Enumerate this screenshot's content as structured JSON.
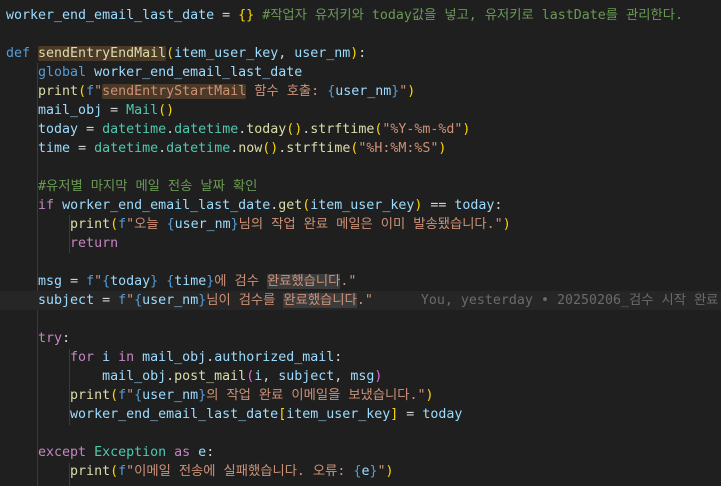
{
  "editor": {
    "lines": [
      [
        [
          "var",
          "worker_end_email_last_date"
        ],
        [
          "op",
          " = "
        ],
        [
          "p1",
          "{}"
        ],
        [
          "cm",
          " #작업자 유저키와 today값을 넣고, 유저키로 lastDate를 관리한다."
        ]
      ],
      [],
      [
        [
          "kw",
          "def "
        ],
        [
          "fn hl",
          "sendEntryEndMail"
        ],
        [
          "p1",
          "("
        ],
        [
          "var",
          "item_user_key"
        ],
        [
          "op",
          ", "
        ],
        [
          "var",
          "user_nm"
        ],
        [
          "p1",
          ")"
        ],
        [
          "op",
          ":"
        ]
      ],
      [
        [
          "op",
          "    "
        ],
        [
          "kw",
          "global "
        ],
        [
          "var",
          "worker_end_email_last_date"
        ]
      ],
      [
        [
          "op",
          "    "
        ],
        [
          "fn",
          "print"
        ],
        [
          "p1",
          "("
        ],
        [
          "kw",
          "f"
        ],
        [
          "str",
          "\""
        ],
        [
          "str hl",
          "sendEntryStartMail"
        ],
        [
          "str",
          " 함수 호출: "
        ],
        [
          "kw",
          "{"
        ],
        [
          "var",
          "user_nm"
        ],
        [
          "kw",
          "}"
        ],
        [
          "str",
          "\""
        ],
        [
          "p1",
          ")"
        ]
      ],
      [
        [
          "op",
          "    "
        ],
        [
          "var",
          "mail_obj"
        ],
        [
          "op",
          " = "
        ],
        [
          "cls",
          "Mail"
        ],
        [
          "p1",
          "()"
        ]
      ],
      [
        [
          "op",
          "    "
        ],
        [
          "var",
          "today"
        ],
        [
          "op",
          " = "
        ],
        [
          "cls",
          "datetime"
        ],
        [
          "op",
          "."
        ],
        [
          "cls",
          "datetime"
        ],
        [
          "op",
          "."
        ],
        [
          "fn",
          "today"
        ],
        [
          "p1",
          "()"
        ],
        [
          "op",
          "."
        ],
        [
          "fn",
          "strftime"
        ],
        [
          "p1",
          "("
        ],
        [
          "str",
          "\"%Y-%m-%d\""
        ],
        [
          "p1",
          ")"
        ]
      ],
      [
        [
          "op",
          "    "
        ],
        [
          "var",
          "time"
        ],
        [
          "op",
          " = "
        ],
        [
          "cls",
          "datetime"
        ],
        [
          "op",
          "."
        ],
        [
          "cls",
          "datetime"
        ],
        [
          "op",
          "."
        ],
        [
          "fn",
          "now"
        ],
        [
          "p1",
          "()"
        ],
        [
          "op",
          "."
        ],
        [
          "fn",
          "strftime"
        ],
        [
          "p1",
          "("
        ],
        [
          "str",
          "\"%H:%M:%S\""
        ],
        [
          "p1",
          ")"
        ]
      ],
      [],
      [
        [
          "op",
          "    "
        ],
        [
          "cm",
          "#유저별 마지막 메일 전송 날짜 확인"
        ]
      ],
      [
        [
          "op",
          "    "
        ],
        [
          "ctl",
          "if "
        ],
        [
          "var",
          "worker_end_email_last_date"
        ],
        [
          "op",
          "."
        ],
        [
          "fn",
          "get"
        ],
        [
          "p1",
          "("
        ],
        [
          "var",
          "item_user_key"
        ],
        [
          "p1",
          ")"
        ],
        [
          "op",
          " == "
        ],
        [
          "var",
          "today"
        ],
        [
          "op",
          ":"
        ]
      ],
      [
        [
          "op",
          "        "
        ],
        [
          "fn",
          "print"
        ],
        [
          "p1",
          "("
        ],
        [
          "kw",
          "f"
        ],
        [
          "str",
          "\"오늘 "
        ],
        [
          "kw",
          "{"
        ],
        [
          "var",
          "user_nm"
        ],
        [
          "kw",
          "}"
        ],
        [
          "str",
          "님의 작업 완료 메일은 이미 발송됐습니다.\""
        ],
        [
          "p1",
          ")"
        ]
      ],
      [
        [
          "op",
          "        "
        ],
        [
          "ctl",
          "return"
        ]
      ],
      [],
      [
        [
          "op",
          "    "
        ],
        [
          "var",
          "msg"
        ],
        [
          "op",
          " = "
        ],
        [
          "kw",
          "f"
        ],
        [
          "str",
          "\""
        ],
        [
          "kw",
          "{"
        ],
        [
          "var",
          "today"
        ],
        [
          "kw",
          "}"
        ],
        [
          "str",
          " "
        ],
        [
          "kw",
          "{"
        ],
        [
          "var",
          "time"
        ],
        [
          "kw",
          "}"
        ],
        [
          "str",
          "에 검수 "
        ],
        [
          "str hl2",
          "완료했습니다"
        ],
        [
          "str",
          ".\""
        ]
      ],
      [
        [
          "op",
          "    "
        ],
        [
          "var",
          "subject"
        ],
        [
          "op",
          " = "
        ],
        [
          "kw",
          "f"
        ],
        [
          "str",
          "\""
        ],
        [
          "kw",
          "{"
        ],
        [
          "var",
          "user_nm"
        ],
        [
          "kw",
          "}"
        ],
        [
          "str",
          "님이 검수를 "
        ],
        [
          "str hl2",
          "완료했습니다"
        ],
        [
          "str",
          ".\""
        ],
        [
          "blame",
          "      You, yesterday • 20250206_검수 시작 완료"
        ]
      ],
      [],
      [
        [
          "op",
          "    "
        ],
        [
          "ctl",
          "try"
        ],
        [
          "op",
          ":"
        ]
      ],
      [
        [
          "op",
          "        "
        ],
        [
          "ctl",
          "for "
        ],
        [
          "var",
          "i"
        ],
        [
          "ctl",
          " in "
        ],
        [
          "var",
          "mail_obj"
        ],
        [
          "op",
          "."
        ],
        [
          "var",
          "authorized_mail"
        ],
        [
          "op",
          ":"
        ]
      ],
      [
        [
          "op",
          "            "
        ],
        [
          "var",
          "mail_obj"
        ],
        [
          "op",
          "."
        ],
        [
          "fn",
          "post_mail"
        ],
        [
          "p2",
          "("
        ],
        [
          "var",
          "i"
        ],
        [
          "op",
          ", "
        ],
        [
          "var",
          "subject"
        ],
        [
          "op",
          ", "
        ],
        [
          "var",
          "msg"
        ],
        [
          "p2",
          ")"
        ]
      ],
      [
        [
          "op",
          "        "
        ],
        [
          "fn",
          "print"
        ],
        [
          "p1",
          "("
        ],
        [
          "kw",
          "f"
        ],
        [
          "str",
          "\""
        ],
        [
          "kw",
          "{"
        ],
        [
          "var",
          "user_nm"
        ],
        [
          "kw",
          "}"
        ],
        [
          "str",
          "의 작업 완료 이메일을 보냈습니다.\""
        ],
        [
          "p1",
          ")"
        ]
      ],
      [
        [
          "op",
          "        "
        ],
        [
          "var",
          "worker_end_email_last_date"
        ],
        [
          "p1",
          "["
        ],
        [
          "var",
          "item_user_key"
        ],
        [
          "p1",
          "]"
        ],
        [
          "op",
          " = "
        ],
        [
          "var",
          "today"
        ]
      ],
      [],
      [
        [
          "op",
          "    "
        ],
        [
          "ctl",
          "except "
        ],
        [
          "cls",
          "Exception"
        ],
        [
          "ctl",
          " as "
        ],
        [
          "var",
          "e"
        ],
        [
          "op",
          ":"
        ]
      ],
      [
        [
          "op",
          "        "
        ],
        [
          "fn",
          "print"
        ],
        [
          "p1",
          "("
        ],
        [
          "kw",
          "f"
        ],
        [
          "str",
          "\"이메일 전송에 실패했습니다. 오류: "
        ],
        [
          "kw",
          "{"
        ],
        [
          "var",
          "e"
        ],
        [
          "kw",
          "}"
        ],
        [
          "str",
          "\""
        ],
        [
          "p1",
          ")"
        ]
      ]
    ]
  },
  "colors": {
    "background": "#1f1f1f",
    "keyword": "#569cd6",
    "control": "#c586c0",
    "function": "#dcdcaa",
    "variable": "#9cdcfe",
    "class": "#4ec9b0",
    "string": "#ce9178",
    "comment": "#6a9955"
  }
}
